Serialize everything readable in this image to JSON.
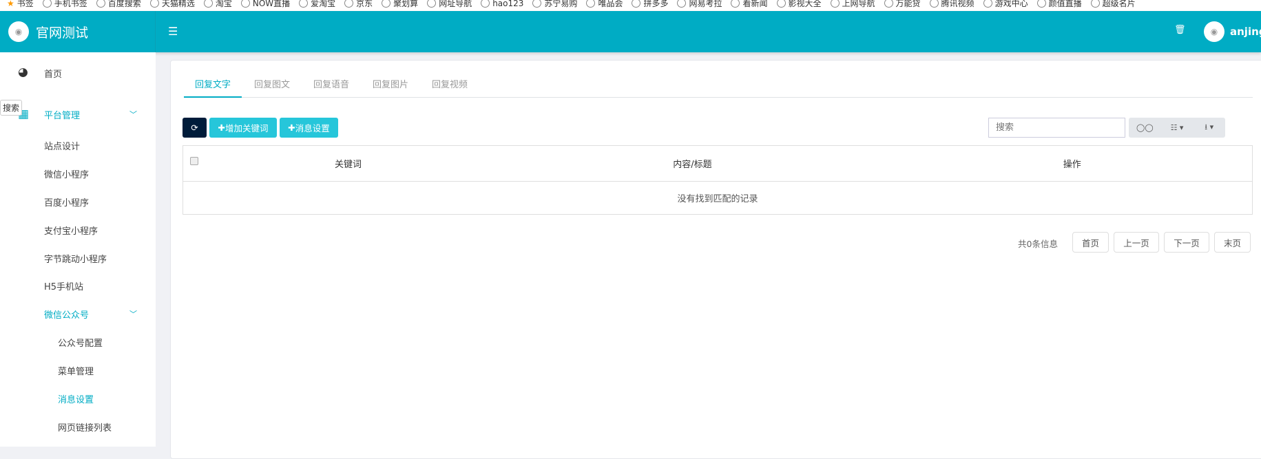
{
  "bookmarks": [
    "书签",
    "手机书签",
    "百度搜索",
    "天猫精选",
    "淘宝",
    "NOW直播",
    "爱淘宝",
    "京东",
    "聚划算",
    "网址导航",
    "hao123",
    "苏宁易购",
    "唯品会",
    "拼多多",
    "网易考拉",
    "看新闻",
    "影视大全",
    "上网导航",
    "万能贷",
    "腾讯视频",
    "游戏中心",
    "颜值直播",
    "超级名片"
  ],
  "header": {
    "app_title": "官网测试",
    "username": "anjingh"
  },
  "tooltip": "搜索",
  "sidebar": {
    "items": [
      {
        "label": "首页"
      },
      {
        "label": "平台管理"
      },
      {
        "label": "站点设计"
      },
      {
        "label": "微信小程序"
      },
      {
        "label": "百度小程序"
      },
      {
        "label": "支付宝小程序"
      },
      {
        "label": "字节跳动小程序"
      },
      {
        "label": "H5手机站"
      },
      {
        "label": "微信公众号"
      },
      {
        "label": "公众号配置"
      },
      {
        "label": "菜单管理"
      },
      {
        "label": "消息设置"
      },
      {
        "label": "网页链接列表"
      }
    ]
  },
  "tabs": [
    "回复文字",
    "回复图文",
    "回复语音",
    "回复图片",
    "回复视频"
  ],
  "toolbar": {
    "add_keyword": "增加关键词",
    "message_settings": "消息设置",
    "search_placeholder": "搜索"
  },
  "table": {
    "columns": [
      "关键词",
      "内容/标题",
      "操作"
    ],
    "empty": "没有找到匹配的记录"
  },
  "pagination": {
    "info": "共0条信息",
    "first": "首页",
    "prev": "上一页",
    "next": "下一页",
    "last": "末页"
  },
  "colors": {
    "primary": "#00acc4",
    "button": "#26c6da",
    "dark": "#001c3a"
  }
}
